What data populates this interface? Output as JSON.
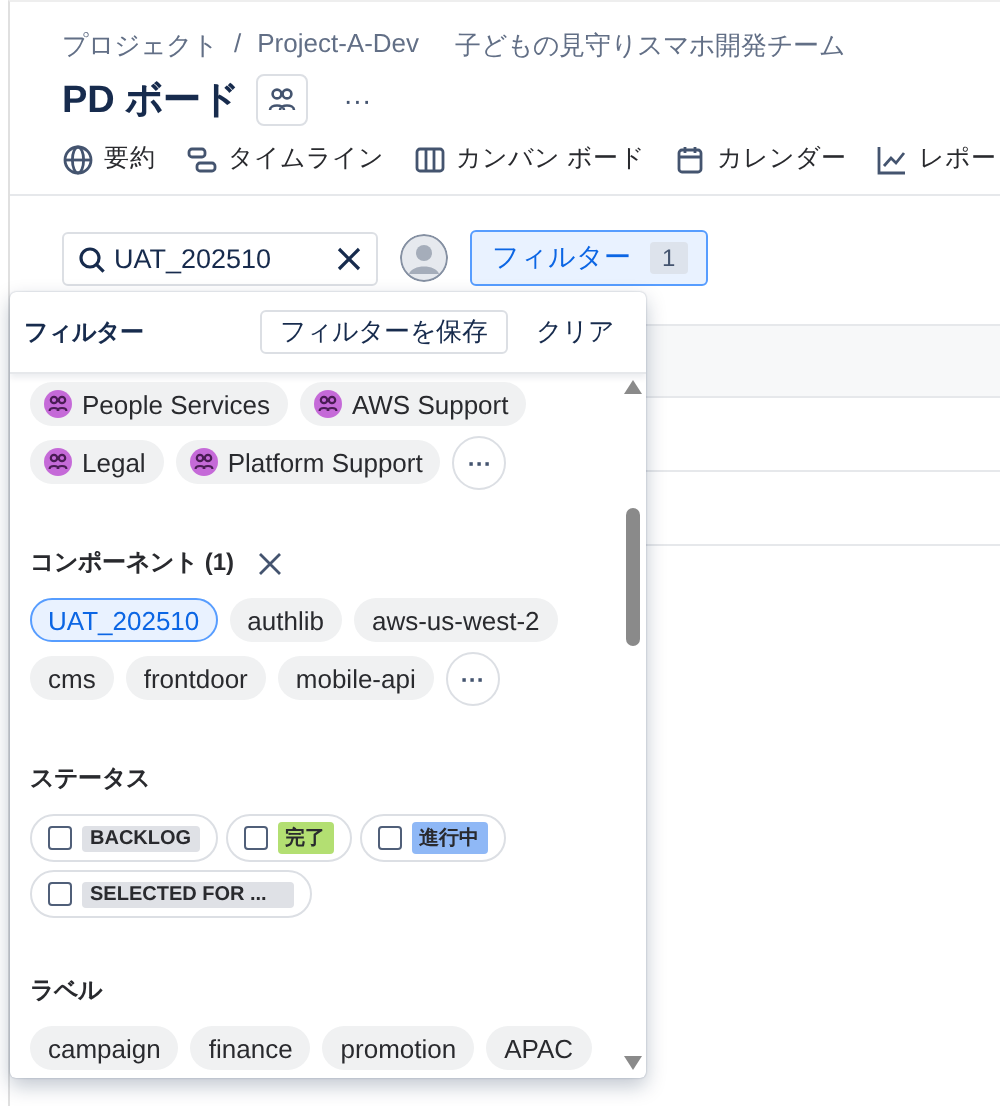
{
  "breadcrumb": {
    "items": [
      "プロジェクト",
      "Project-A-Dev"
    ],
    "separator": "/",
    "subtitle": "子どもの見守りスマホ開発チーム"
  },
  "title": "PD ボード",
  "title_more": "···",
  "tabs": [
    {
      "kind": "globe",
      "label": "要約"
    },
    {
      "kind": "timeline",
      "label": "タイムライン"
    },
    {
      "kind": "columns",
      "label": "カンバン ボード"
    },
    {
      "kind": "calendar",
      "label": "カレンダー"
    },
    {
      "kind": "chart",
      "label": "レポー"
    }
  ],
  "search": {
    "value": "UAT_202510"
  },
  "filter_button": {
    "label": "フィルター",
    "count": "1",
    "selected": true
  },
  "filter_panel": {
    "title": "フィルター",
    "save": "フィルターを保存",
    "clear": "クリア",
    "sections": [
      {
        "kind": "teams",
        "chips": [
          {
            "label": "People Services"
          },
          {
            "label": "AWS Support"
          },
          {
            "label": "Legal"
          },
          {
            "label": "Platform Support"
          }
        ],
        "more": "···"
      },
      {
        "kind": "tags",
        "heading": "コンポーネント (1)",
        "chips": [
          {
            "label": "UAT_202510",
            "selected": true
          },
          {
            "label": "authlib",
            "selected": false
          },
          {
            "label": "aws-us-west-2",
            "selected": false
          },
          {
            "label": "cms",
            "selected": false
          },
          {
            "label": "frontdoor",
            "selected": false
          },
          {
            "label": "mobile-api",
            "selected": false
          }
        ],
        "more": "···"
      },
      {
        "kind": "status",
        "heading": "ステータス",
        "chips": [
          {
            "label": "BACKLOG",
            "checked": false,
            "color": "#dfe1e6"
          },
          {
            "label": "完了",
            "checked": false,
            "color": "#b3df72"
          },
          {
            "label": "進行中",
            "checked": false,
            "color": "#8fb8f6"
          },
          {
            "label": "SELECTED FOR ...",
            "checked": false,
            "color": "#dfe1e6"
          }
        ]
      },
      {
        "kind": "tags",
        "heading": "ラベル",
        "chips": [
          {
            "label": "campaign",
            "selected": false
          },
          {
            "label": "finance",
            "selected": false
          },
          {
            "label": "promotion",
            "selected": false
          },
          {
            "label": "APAC",
            "selected": false
          }
        ]
      }
    ]
  }
}
